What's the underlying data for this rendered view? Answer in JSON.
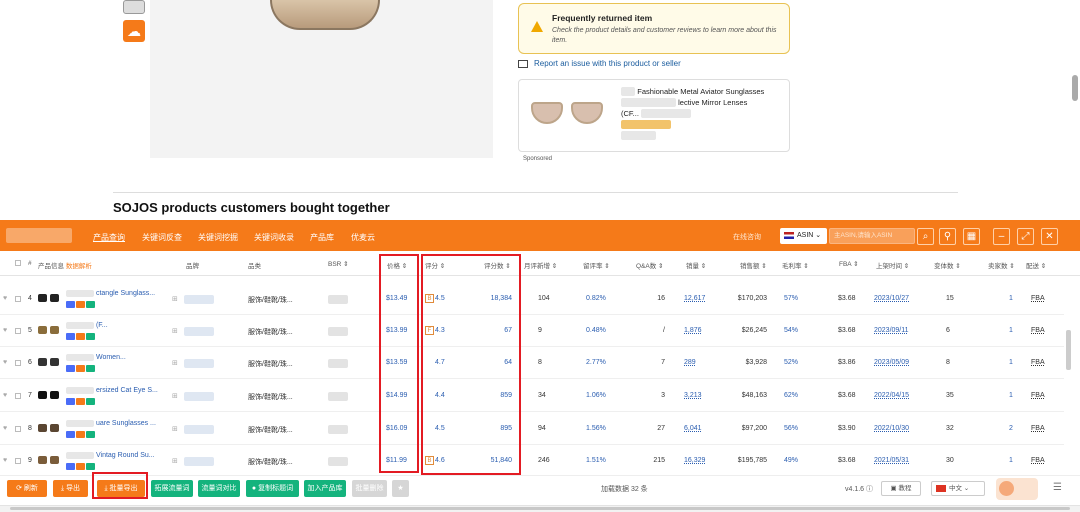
{
  "amazon": {
    "notice_title": "Frequently returned item",
    "notice_desc": "Check the product details and customer reviews to learn more about this item.",
    "report_link": "Report an issue with this product or seller",
    "ad_title_line1": "Fashionable Metal Aviator Sunglasses",
    "ad_title_line2": "lective Mirror Lenses",
    "ad_title_line3": "(CF...",
    "sponsored": "Sponsored",
    "section_title": "SOJOS products customers bought together"
  },
  "toolbar": {
    "tabs": [
      "产品查询",
      "关键词反查",
      "关键词挖掘",
      "关键词收录",
      "产品库",
      "优麦云"
    ],
    "online_label": "在线咨询",
    "asin_select": "ASIN",
    "search_placeholder": "主ASIN,请输入ASIN"
  },
  "table": {
    "headers": {
      "product": "产品信息",
      "product_extra": "数据解析",
      "brand": "品牌",
      "category": "品类",
      "bsr": "BSR",
      "price": "价格",
      "rating": "评分",
      "reviews": "评分数",
      "monthly_new": "月评新增",
      "retention": "留评率",
      "qa": "Q&A数",
      "sales": "销量",
      "revenue": "销售额",
      "margin": "毛利率",
      "fba": "FBA",
      "listed": "上架时间",
      "variants": "变体数",
      "sellers": "卖家数",
      "shipping": "配送"
    },
    "rows": [
      {
        "rank": "4",
        "title": "ctangle Sunglass...",
        "category": "服饰/鞋靴/珠...",
        "bsr": "",
        "price": "$13.49",
        "rating_badge": "B",
        "rating": "4.5",
        "reviews": "18,384",
        "monthly": "104",
        "retention": "0.82%",
        "qa": "16",
        "sales": "12,617",
        "revenue": "$170,203",
        "margin": "57%",
        "fba_fee": "$3.68",
        "listed": "2023/10/27",
        "variants": "15",
        "sellers": "1",
        "ship": "FBA"
      },
      {
        "rank": "5",
        "title": "(F...",
        "category": "服饰/鞋靴/珠...",
        "bsr": "",
        "price": "$13.99",
        "rating_badge": "F",
        "rating": "4.3",
        "reviews": "67",
        "monthly": "9",
        "retention": "0.48%",
        "qa": "/",
        "sales": "1,876",
        "revenue": "$26,245",
        "margin": "54%",
        "fba_fee": "$3.68",
        "listed": "2023/09/11",
        "variants": "6",
        "sellers": "1",
        "ship": "FBA"
      },
      {
        "rank": "6",
        "title": "Women...",
        "category": "服饰/鞋靴/珠...",
        "bsr": "",
        "price": "$13.59",
        "rating_badge": "",
        "rating": "4.7",
        "reviews": "64",
        "monthly": "8",
        "retention": "2.77%",
        "qa": "7",
        "sales": "289",
        "revenue": "$3,928",
        "margin": "52%",
        "fba_fee": "$3.86",
        "listed": "2023/05/09",
        "variants": "8",
        "sellers": "1",
        "ship": "FBA"
      },
      {
        "rank": "7",
        "title": "ersized Cat Eye S...",
        "category": "服饰/鞋靴/珠...",
        "bsr": "",
        "price": "$14.99",
        "rating_badge": "",
        "rating": "4.4",
        "reviews": "859",
        "monthly": "34",
        "retention": "1.06%",
        "qa": "3",
        "sales": "3,213",
        "revenue": "$48,163",
        "margin": "62%",
        "fba_fee": "$3.68",
        "listed": "2022/04/15",
        "variants": "35",
        "sellers": "1",
        "ship": "FBA"
      },
      {
        "rank": "8",
        "title": "uare Sunglasses ...",
        "category": "服饰/鞋靴/珠...",
        "bsr": "",
        "price": "$16.09",
        "rating_badge": "",
        "rating": "4.5",
        "reviews": "895",
        "monthly": "94",
        "retention": "1.56%",
        "qa": "27",
        "sales": "6,041",
        "revenue": "$97,200",
        "margin": "56%",
        "fba_fee": "$3.90",
        "listed": "2022/10/30",
        "variants": "32",
        "sellers": "2",
        "ship": "FBA"
      },
      {
        "rank": "9",
        "title": "Vintag  Round Su...",
        "category": "服饰/鞋靴/珠...",
        "bsr": "",
        "price": "$11.99",
        "rating_badge": "B",
        "rating": "4.6",
        "reviews": "51,840",
        "monthly": "246",
        "retention": "1.51%",
        "qa": "215",
        "sales": "16,329",
        "revenue": "$195,785",
        "margin": "49%",
        "fba_fee": "$3.68",
        "listed": "2021/05/31",
        "variants": "30",
        "sellers": "1",
        "ship": "FBA"
      }
    ]
  },
  "bottom": {
    "refresh": "刷新",
    "export": "导出",
    "batch_export": "批量导出",
    "expand_kw": "拓展流量词",
    "traffic_compare": "流量词对比",
    "copy_title": "复制标题词",
    "add_to_lib": "加入产品库",
    "batch_delete": "批量删除",
    "loaded_count": "加载数据 32 条",
    "version": "v4.1.6",
    "tutorial": "教程",
    "language": "中文"
  }
}
